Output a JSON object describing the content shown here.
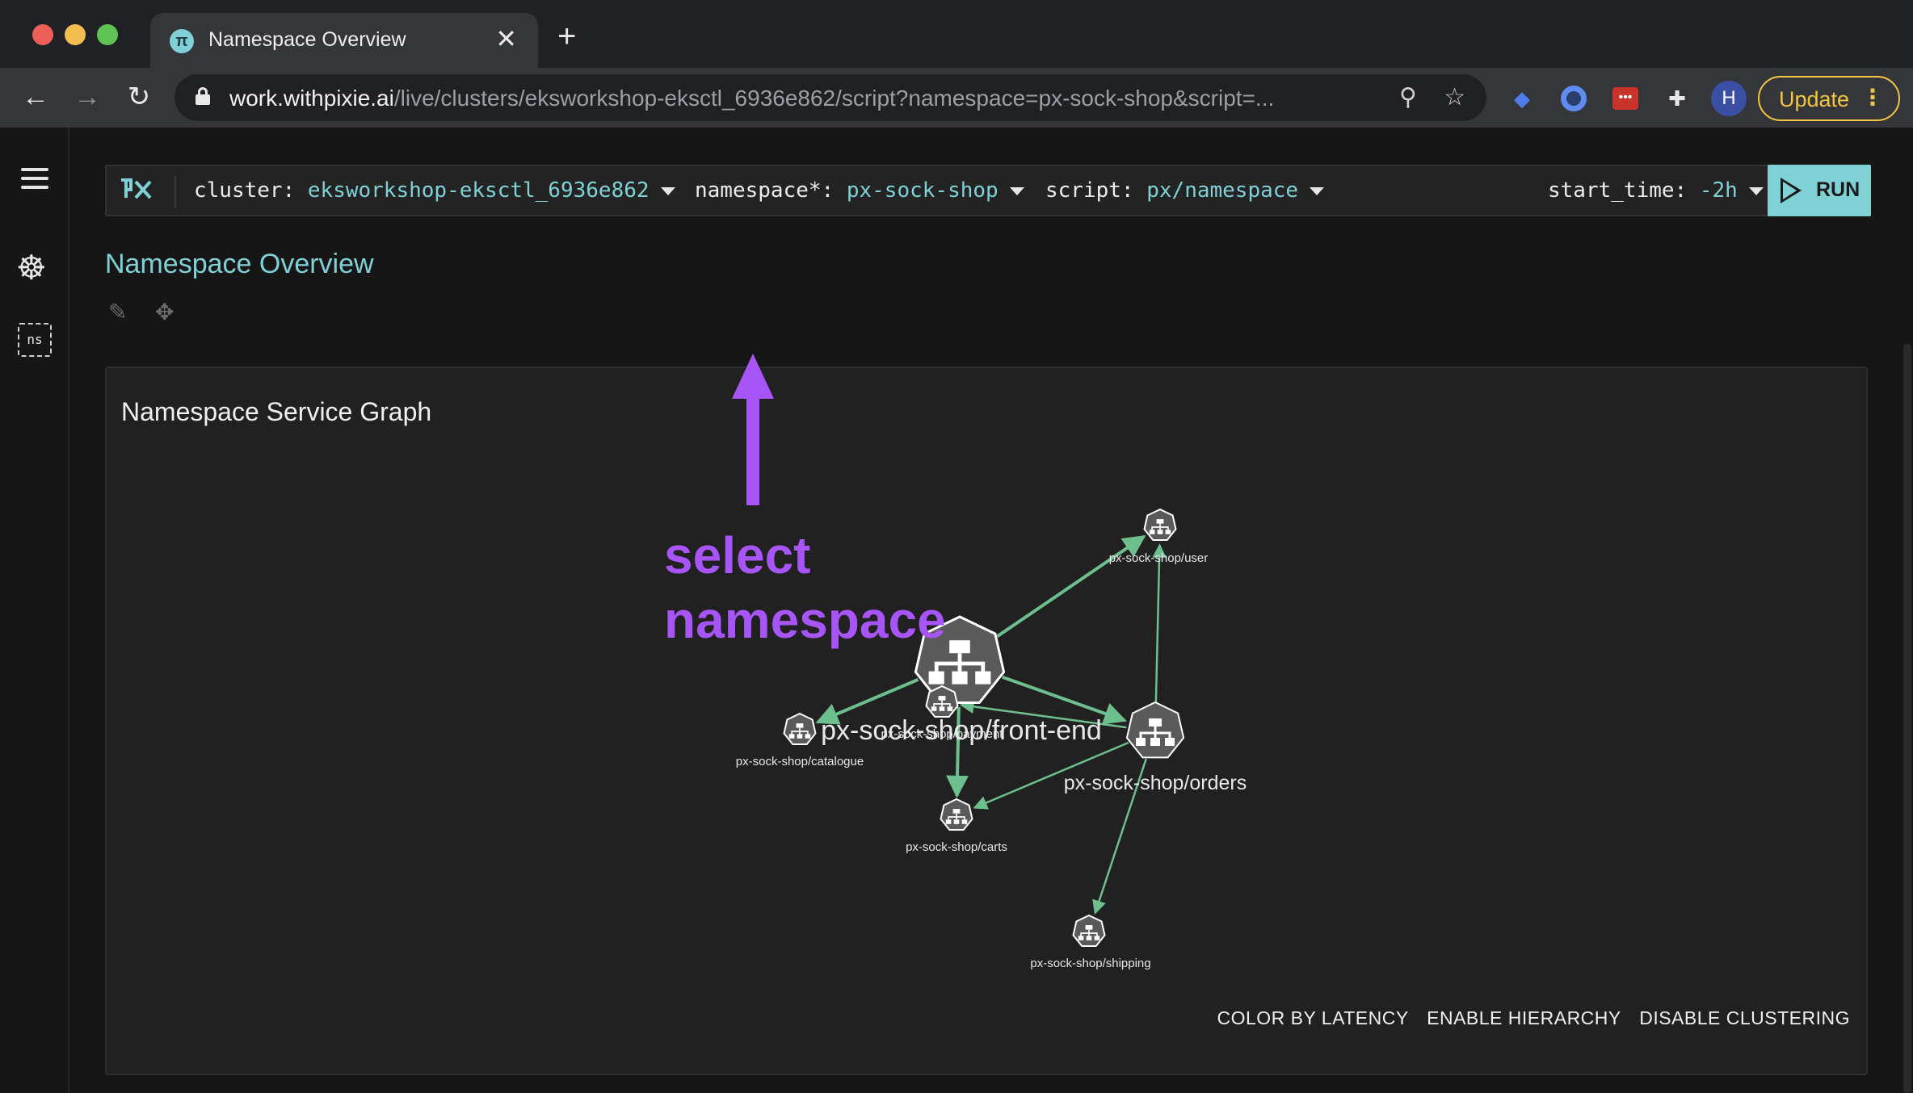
{
  "browser": {
    "tab_title": "Namespace Overview",
    "tab_close": "✕",
    "new_tab": "+",
    "url_host": "work.withpixie.ai",
    "url_path": "/live/clusters/eksworkshop-eksctl_6936e862/script?namespace=px-sock-shop&script=...",
    "profile_initial": "H",
    "update_label": "Update",
    "ext_pw_glyph": "•••"
  },
  "cmdbar": {
    "logo": "PX",
    "args": [
      {
        "key": "cluster:",
        "value": "eksworkshop-eksctl_6936e862"
      },
      {
        "key": "namespace*:",
        "value": "px-sock-shop"
      },
      {
        "key": "script:",
        "value": "px/namespace"
      },
      {
        "key": "start_time:",
        "value": "-2h"
      }
    ],
    "run_label": "RUN"
  },
  "sidenav": {
    "ns_label": "ns"
  },
  "page": {
    "title": "Namespace Overview"
  },
  "card": {
    "title": "Namespace Service Graph",
    "options": [
      "COLOR BY LATENCY",
      "ENABLE HIERARCHY",
      "DISABLE CLUSTERING"
    ]
  },
  "graph": {
    "nodes": [
      {
        "id": "front-end",
        "label": "px-sock-shop/front-end",
        "size": "large"
      },
      {
        "id": "user",
        "label": "px-sock-shop/user",
        "size": "small"
      },
      {
        "id": "orders",
        "label": "px-sock-shop/orders",
        "size": "medium"
      },
      {
        "id": "payment",
        "label": "px-sock-shop/payment",
        "size": "small"
      },
      {
        "id": "catalogue",
        "label": "px-sock-shop/catalogue",
        "size": "small"
      },
      {
        "id": "carts",
        "label": "px-sock-shop/carts",
        "size": "small"
      },
      {
        "id": "shipping",
        "label": "px-sock-shop/shipping",
        "size": "small"
      }
    ],
    "edges": [
      {
        "from": "front-end",
        "to": "user"
      },
      {
        "from": "front-end",
        "to": "catalogue"
      },
      {
        "from": "front-end",
        "to": "orders"
      },
      {
        "from": "front-end",
        "to": "carts"
      },
      {
        "from": "orders",
        "to": "user"
      },
      {
        "from": "orders",
        "to": "payment"
      },
      {
        "from": "orders",
        "to": "carts"
      },
      {
        "from": "orders",
        "to": "shipping"
      }
    ],
    "edge_color": "#6dbf8e",
    "node_color": "#5a5a5a"
  },
  "annotation": {
    "lines": [
      "select",
      "namespace"
    ],
    "color": "#a855f7"
  },
  "colors": {
    "accent": "#7fd1d6",
    "update": "#f4c542"
  }
}
